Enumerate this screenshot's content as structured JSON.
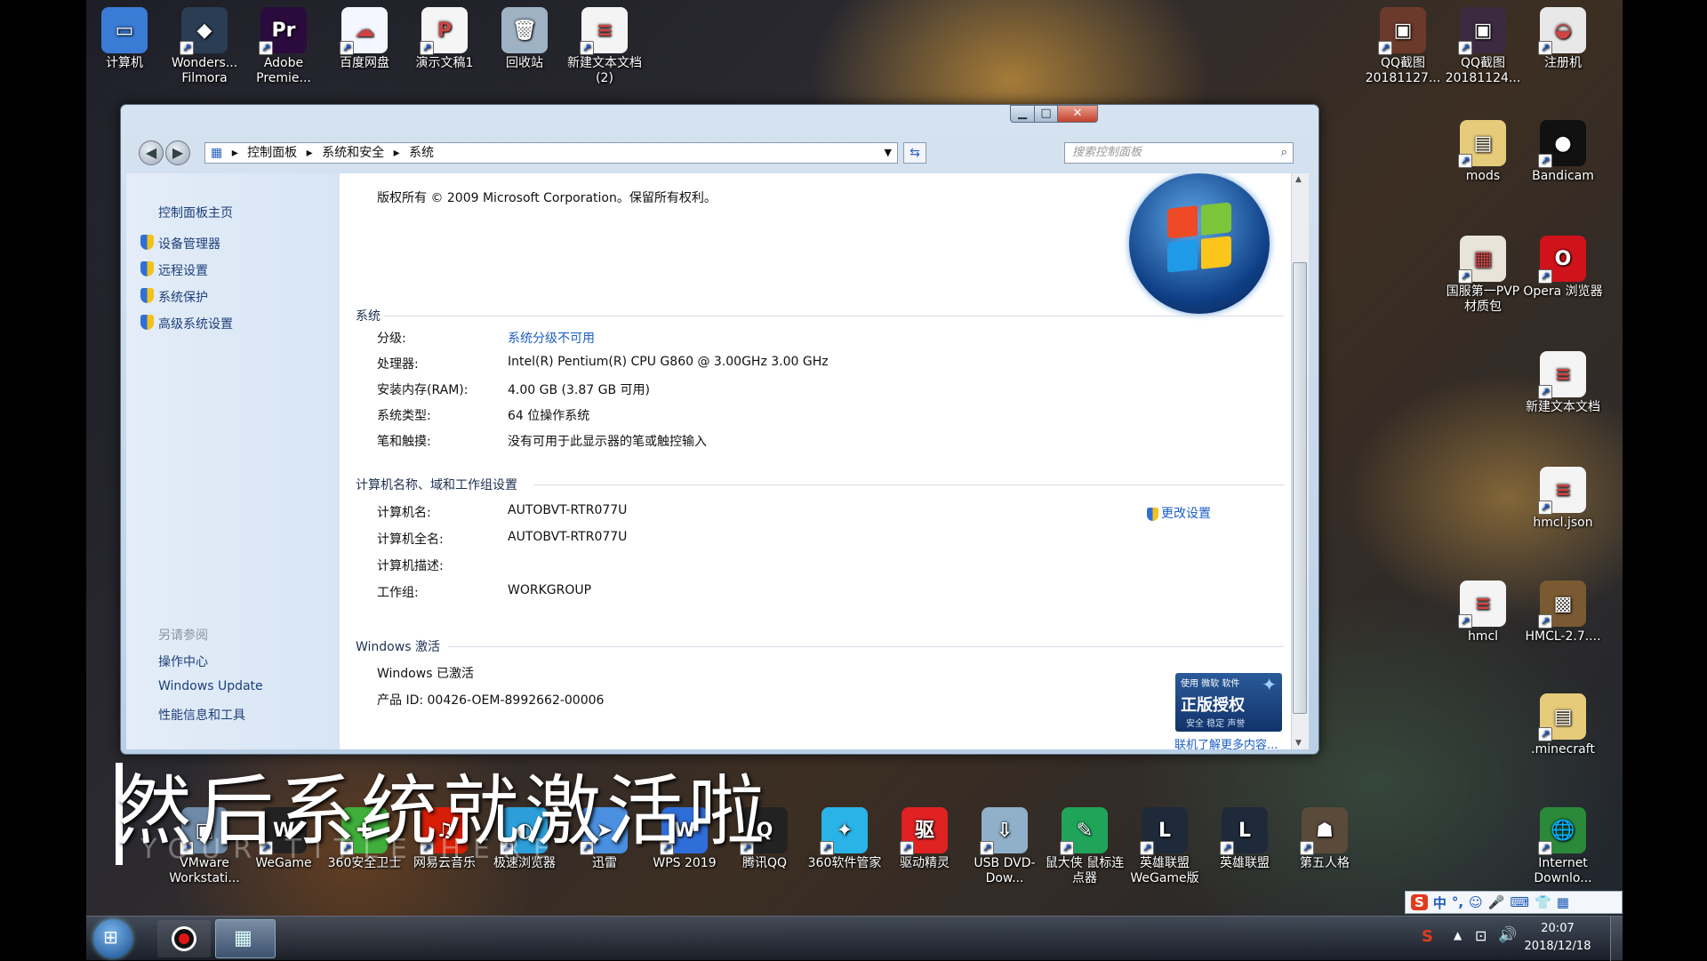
{
  "desktop_icons": [
    {
      "label": "计算机",
      "color": "#3a7bd5",
      "glyph": "▭",
      "icon": "computer-icon"
    },
    {
      "label": "Wonders... Filmora",
      "color": "#2a3d52",
      "glyph": "◆",
      "icon": "filmora-icon"
    },
    {
      "label": "Adobe Premie...",
      "color": "#2b0a3d",
      "glyph": "Pr",
      "icon": "premiere-icon"
    },
    {
      "label": "百度网盘",
      "color": "#f4f7ff",
      "glyph": "☁",
      "icon": "baidu-netdisk-icon"
    },
    {
      "label": "演示文稿1",
      "color": "#f5f5f5",
      "glyph": "P",
      "icon": "presentation-file-icon"
    },
    {
      "label": "回收站",
      "color": "#9fb2c4",
      "glyph": "🗑",
      "icon": "recycle-bin-icon"
    },
    {
      "label": "新建文本文档 (2)",
      "color": "#f4f4f4",
      "glyph": "≡",
      "icon": "text-file-icon"
    },
    {
      "label": "QQ截图 20181127...",
      "color": "#6b3a2a",
      "glyph": "▣",
      "icon": "image-file-icon"
    },
    {
      "label": "QQ截图 20181124...",
      "color": "#3b2a40",
      "glyph": "▣",
      "icon": "image-file-icon"
    },
    {
      "label": "注册机",
      "color": "#e8e8e8",
      "glyph": "◒",
      "icon": "keygen-icon"
    },
    {
      "label": "mods",
      "color": "#e6cc7a",
      "glyph": "▤",
      "icon": "folder-icon"
    },
    {
      "label": "Bandicam",
      "color": "#111",
      "glyph": "●",
      "icon": "bandicam-icon"
    },
    {
      "label": "国服第一PVP材质包",
      "color": "#e9e4da",
      "glyph": "▦",
      "icon": "archive-icon"
    },
    {
      "label": "Opera 浏览器",
      "color": "#d0121b",
      "glyph": "O",
      "icon": "opera-icon"
    },
    {
      "label": "新建文本文档",
      "color": "#f4f4f4",
      "glyph": "≡",
      "icon": "text-file-icon"
    },
    {
      "label": "hmcl.json",
      "color": "#f4f4f4",
      "glyph": "≡",
      "icon": "json-file-icon"
    },
    {
      "label": "hmcl",
      "color": "#f4f4f4",
      "glyph": "≡",
      "icon": "file-icon"
    },
    {
      "label": "HMCL-2.7....",
      "color": "#7a5a32",
      "glyph": "▩",
      "icon": "hmcl-icon"
    },
    {
      "label": ".minecraft",
      "color": "#e6cc7a",
      "glyph": "▤",
      "icon": "folder-icon"
    },
    {
      "label": "VMware Workstati...",
      "color": "#6e8aa8",
      "glyph": "▣",
      "icon": "vmware-icon"
    },
    {
      "label": "WeGame",
      "color": "#222",
      "glyph": "W",
      "icon": "wegame-icon"
    },
    {
      "label": "360安全卫士",
      "color": "#3fae3a",
      "glyph": "✚",
      "icon": "360-security-icon"
    },
    {
      "label": "网易云音乐",
      "color": "#d81e06",
      "glyph": "♫",
      "icon": "netease-music-icon"
    },
    {
      "label": "极速浏览器",
      "color": "#2c9ed8",
      "glyph": "◐",
      "icon": "browser-icon"
    },
    {
      "label": "迅雷",
      "color": "#4a8fe0",
      "glyph": "➤",
      "icon": "thunder-icon"
    },
    {
      "label": "WPS 2019",
      "color": "#2f6ed8",
      "glyph": "W",
      "icon": "wps-icon"
    },
    {
      "label": "腾讯QQ",
      "color": "#222",
      "glyph": "Q",
      "icon": "qq-icon"
    },
    {
      "label": "360软件管家",
      "color": "#2ab3e6",
      "glyph": "✦",
      "icon": "360-software-icon"
    },
    {
      "label": "驱动精灵",
      "color": "#e02222",
      "glyph": "驱",
      "icon": "driver-genius-icon"
    },
    {
      "label": "USB DVD-Dow...",
      "color": "#8fb0c8",
      "glyph": "⇩",
      "icon": "usb-dvd-tool-icon"
    },
    {
      "label": "鼠大侠 鼠标连点器",
      "color": "#1fa45a",
      "glyph": "✎",
      "icon": "mouse-clicker-icon"
    },
    {
      "label": "英雄联盟 WeGame版",
      "color": "#1e2a3a",
      "glyph": "L",
      "icon": "lol-icon"
    },
    {
      "label": "英雄联盟",
      "color": "#1e2a3a",
      "glyph": "L",
      "icon": "lol-icon"
    },
    {
      "label": "第五人格",
      "color": "#5a4a3a",
      "glyph": "☗",
      "icon": "identity-v-icon"
    },
    {
      "label": "Internet Downlo...",
      "color": "#2a8a3a",
      "glyph": "🌐",
      "icon": "internet-download-icon"
    }
  ],
  "window": {
    "controls": {
      "minimize": "▁",
      "maximize": "□",
      "close": "✕"
    },
    "breadcrumb": [
      "控制面板",
      "系统和安全",
      "系统"
    ],
    "search_placeholder": "搜索控制面板",
    "left_nav": {
      "home": "控制面板主页",
      "tasks": [
        "设备管理器",
        "远程设置",
        "系统保护",
        "高级系统设置"
      ],
      "see_also_title": "另请参阅",
      "see_also": [
        "操作中心",
        "Windows Update",
        "性能信息和工具"
      ]
    },
    "copyright": "版权所有 © 2009 Microsoft Corporation。保留所有权利。",
    "system": {
      "title": "系统",
      "rows": [
        {
          "label": "分级:",
          "value": "系统分级不可用",
          "link": true
        },
        {
          "label": "处理器:",
          "value": "Intel(R) Pentium(R) CPU G860 @ 3.00GHz   3.00 GHz",
          "link": false
        },
        {
          "label": "安装内存(RAM):",
          "value": "4.00 GB (3.87 GB 可用)",
          "link": false
        },
        {
          "label": "系统类型:",
          "value": "64 位操作系统",
          "link": false
        },
        {
          "label": "笔和触摸:",
          "value": "没有可用于此显示器的笔或触控输入",
          "link": false
        }
      ]
    },
    "computer": {
      "title": "计算机名称、域和工作组设置",
      "change": "更改设置",
      "rows": [
        {
          "label": "计算机名:",
          "value": "AUTOBVT-RTR077U"
        },
        {
          "label": "计算机全名:",
          "value": "AUTOBVT-RTR077U"
        },
        {
          "label": "计算机描述:",
          "value": ""
        },
        {
          "label": "工作组:",
          "value": "WORKGROUP"
        }
      ]
    },
    "activation": {
      "title": "Windows 激活",
      "status": "Windows 已激活",
      "product_id": "产品 ID: 00426-OEM-8992662-00006",
      "badge_top": "使用 微软 软件",
      "badge_main": "正版授权",
      "badge_sub": "安全 稳定 声誉",
      "learn_more": "联机了解更多内容..."
    }
  },
  "overlay": {
    "subtitle": "然后系统就激活啦",
    "watermark": "YOUR TITLE HERE"
  },
  "taskbar": {
    "time": "20:07",
    "date": "2018/12/18"
  },
  "ime": {
    "label": "中"
  }
}
